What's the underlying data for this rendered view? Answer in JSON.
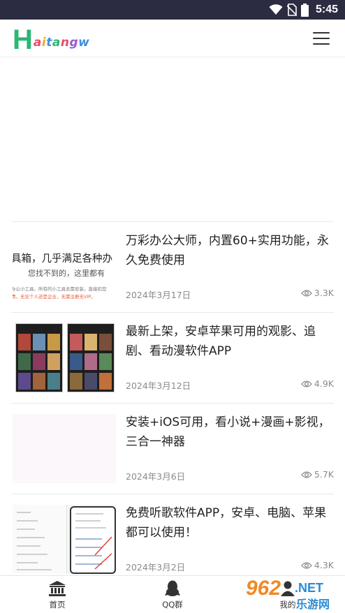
{
  "status_bar": {
    "time": "5:45"
  },
  "header": {
    "logo_first": "H",
    "logo_rest": [
      {
        "ch": "a",
        "color": "#e94b6a"
      },
      {
        "ch": "i",
        "color": "#f5a623"
      },
      {
        "ch": "t",
        "color": "#3b8fe0"
      },
      {
        "ch": "a",
        "color": "#2bb673"
      },
      {
        "ch": "n",
        "color": "#e94b6a"
      },
      {
        "ch": "g",
        "color": "#9b59d0"
      },
      {
        "ch": "w",
        "color": "#3b8fe0"
      }
    ],
    "menu_icon": "hamburger-icon"
  },
  "articles": [
    {
      "title": "万彩办公大师，内置60+实用功能，永久免费使用",
      "date": "2024年3月17日",
      "views": "3.3K",
      "thumb_text": {
        "line1": "具箱，几乎满足各种办",
        "line2": "您找不到的，这里都有",
        "line3": "办公小工具，所有的小工具无需安装，直接扣您",
        "line4": "费，无论个人还是企业，无需注册无VIP。"
      }
    },
    {
      "title": "最新上架，安卓苹果可用的观影、追剧、看动漫软件APP",
      "date": "2024年3月12日",
      "views": "4.9K"
    },
    {
      "title": "安装+iOS可用，看小说+漫画+影视，三合一神器",
      "date": "2024年3月6日",
      "views": "5.7K"
    },
    {
      "title": "免费听歌软件APP，安卓、电脑、苹果都可以使用！",
      "date": "2024年3月2日",
      "views": "4.3K"
    }
  ],
  "bottom_nav": {
    "home_label": "首页",
    "qq_label": "QQ群",
    "third_label": "我的"
  },
  "watermark": {
    "num": "962",
    "net": ".NET",
    "cn": "乐游网"
  }
}
